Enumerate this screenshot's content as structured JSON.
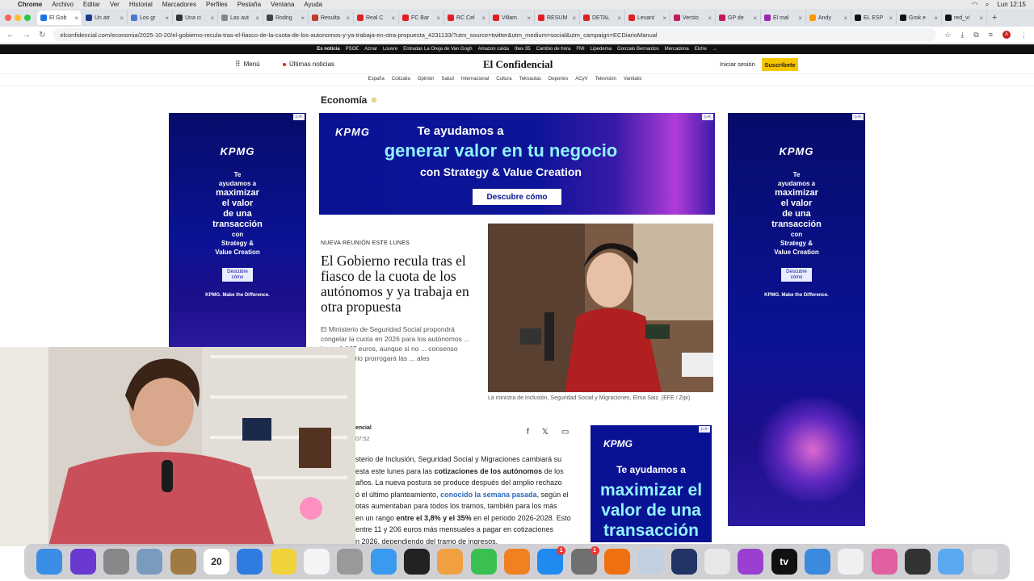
{
  "menubar": {
    "app": "Chrome",
    "items": [
      "Archivo",
      "Editar",
      "Ver",
      "Historial",
      "Marcadores",
      "Perfiles",
      "Pestaña",
      "Ventana",
      "Ayuda"
    ],
    "clock": "Lun 12:15"
  },
  "tabs": [
    {
      "label": "El Gob",
      "color": "#1a73e8",
      "active": true
    },
    {
      "label": "Un atr",
      "color": "#1a3a8f"
    },
    {
      "label": "Los gr",
      "color": "#4a7bd0"
    },
    {
      "label": "Una ci",
      "color": "#333333"
    },
    {
      "label": "Las aut",
      "color": "#888888"
    },
    {
      "label": "Rodrig",
      "color": "#444444"
    },
    {
      "label": "Resulta",
      "color": "#c0392b"
    },
    {
      "label": "Real C",
      "color": "#e02020"
    },
    {
      "label": "FC Bar",
      "color": "#e02020"
    },
    {
      "label": "RC Cel",
      "color": "#e02020"
    },
    {
      "label": "Villam",
      "color": "#e02020"
    },
    {
      "label": "RESUM",
      "color": "#e02020"
    },
    {
      "label": "DETAL",
      "color": "#e02020"
    },
    {
      "label": "Levant",
      "color": "#e02020"
    },
    {
      "label": "Versto",
      "color": "#c2185b"
    },
    {
      "label": "GP de",
      "color": "#c2185b"
    },
    {
      "label": "El mal",
      "color": "#9c27b0"
    },
    {
      "label": "Andy",
      "color": "#ff9800"
    },
    {
      "label": "EL ESP",
      "color": "#111111"
    },
    {
      "label": "Grok e",
      "color": "#111111"
    },
    {
      "label": "red_vi",
      "color": "#111111"
    }
  ],
  "address": {
    "url": "elconfidencial.com/economia/2025-10-20/el-gobierno-recula-tras-el-fiasco-de-la-cuota-de-los-autonomos-y-ya-trabaja-en-otra-propuesta_4231133/?utm_source=twitter&utm_medium=social&utm_campaign=ECDiarioManual"
  },
  "trending": {
    "lead": "Es noticia",
    "items": [
      "PSOE",
      "Aznar",
      "Louvre",
      "Entradas La Oreja de Van Gogh",
      "Amazon caída",
      "Ibex 35",
      "Cambio de hora",
      "FMI",
      "Lipedema",
      "Gonzalo Bernardos",
      "Mercadona",
      "Elche",
      "→"
    ]
  },
  "header": {
    "menu": "Menú",
    "latest": "Últimas noticias",
    "logo": "El Confidencial",
    "login": "Iniciar sesión",
    "subscribe": "Suscríbete"
  },
  "sections": [
    "España",
    "Cotizalia",
    "Opinión",
    "Salud",
    "Internacional",
    "Cultura",
    "Teknautas",
    "Deportes",
    "ACyV",
    "Televisión",
    "Vanitatis"
  ],
  "category": "Economía",
  "ads": {
    "brand": "KPMG",
    "top_line1": "Te ayudamos a",
    "top_line2": "generar valor en tu negocio",
    "top_line3": "con Strategy & Value Creation",
    "top_cta": "Descubre cómo",
    "side_l1": "Te",
    "side_l2": "ayudamos a",
    "side_l3": "maximizar",
    "side_l4": "el valor",
    "side_l5": "de una",
    "side_l6": "transacción",
    "side_l7": "con",
    "side_l8": "Strategy &",
    "side_l9": "Value Creation",
    "side_cta": "Descubre cómo",
    "side_tag": "KPMG. Make the Difference.",
    "mid_l1": "Te ayudamos a",
    "mid_l2": "maximizar el valor de una transacción"
  },
  "article": {
    "kicker": "NUEVA REUNIÓN ESTE LUNES",
    "headline": "El Gobierno recula tras el fiasco de la cuota de los autónomos y ya trabaja en otra propuesta",
    "lead": "El Ministerio de Seguridad Social propondrá congelar la cuota en 2026 para los autónomos ... hasta 1.167 euros, aunque si no ... consenso parlamentario prorrogará las ... ales",
    "caption": "La ministra de Inclusión, Seguridad Social y Migraciones, Elma Saiz. (EFE / Zipi)",
    "author": "encial",
    "time": "07:52",
    "body_1": "sterio de Inclusión, Seguridad Social y Migraciones cambiará su",
    "body_2a": "esta este lunes para las ",
    "body_2b": "cotizaciones de los autónomos",
    "body_2c": " de los",
    "body_3": "años. La nueva postura se produce después del amplio rechazo",
    "body_4a": "ó el último planteamiento, ",
    "body_4b": "conocido la semana pasada",
    "body_4c": ", según el",
    "body_5": "otas aumentaban para todos los tramos, también para los más",
    "body_6a": " en un rango ",
    "body_6b": "entre el 3,8% y el 35%",
    "body_6c": " en el periodo 2026-2028. Esto",
    "body_7": "entre 11 y 206 euros más mensuales a pagar en cotizaciones",
    "body_8": "n 2026, dependiendo del tramo de ingresos."
  },
  "dock": [
    {
      "name": "finder",
      "color": "#3a8ee6"
    },
    {
      "name": "siri",
      "color": "#6a3ad0"
    },
    {
      "name": "launchpad",
      "color": "#888888"
    },
    {
      "name": "preview",
      "color": "#7a9ac0"
    },
    {
      "name": "notes-app",
      "color": "#a07a40"
    },
    {
      "name": "calendar",
      "color": "#ffffff",
      "label": "20"
    },
    {
      "name": "safari",
      "color": "#2f7be0"
    },
    {
      "name": "notes",
      "color": "#f2d23a"
    },
    {
      "name": "reminders",
      "color": "#f4f4f4"
    },
    {
      "name": "script",
      "color": "#999999"
    },
    {
      "name": "messenger",
      "color": "#3a9af0"
    },
    {
      "name": "final-cut",
      "color": "#222222"
    },
    {
      "name": "photos",
      "color": "#f0a040"
    },
    {
      "name": "facetime",
      "color": "#3ac050"
    },
    {
      "name": "books",
      "color": "#f08020"
    },
    {
      "name": "app-store",
      "color": "#1f8af0",
      "badge": "1"
    },
    {
      "name": "system-settings",
      "color": "#707070",
      "badge": "1"
    },
    {
      "name": "vlc",
      "color": "#f07010"
    },
    {
      "name": "maps",
      "color": "#c0d0e0"
    },
    {
      "name": "quicktime",
      "color": "#223366"
    },
    {
      "name": "chrome",
      "color": "#e8e8e8"
    },
    {
      "name": "podcasts",
      "color": "#9a40d0"
    },
    {
      "name": "apple-tv",
      "color": "#111111",
      "label": "tv"
    },
    {
      "name": "network-app",
      "color": "#3a8ae0"
    },
    {
      "name": "music",
      "color": "#f0f0f0"
    },
    {
      "name": "screen-sharing",
      "color": "#e060a0"
    },
    {
      "name": "activity",
      "color": "#333333"
    },
    {
      "name": "folder",
      "color": "#5aa8f0"
    },
    {
      "name": "trash",
      "color": "#dcdcdc"
    }
  ]
}
